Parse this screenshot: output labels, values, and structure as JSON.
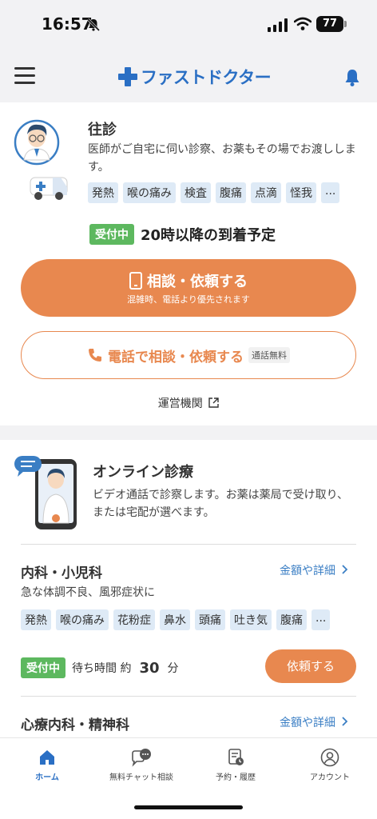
{
  "status": {
    "time": "16:57",
    "battery": "77"
  },
  "header": {
    "brand": "ファストドクター"
  },
  "house_call": {
    "title": "往診",
    "description": "医師がご自宅に伺い診察、お薬もその場でお渡しします。",
    "tags": [
      "発熱",
      "喉の痛み",
      "検査",
      "腹痛",
      "点滴",
      "怪我",
      "..."
    ],
    "status_badge": "受付中",
    "arrival": "20時以降の到着予定",
    "consult_button": "相談・依頼する",
    "consult_sub": "混雑時、電話より優先されます",
    "phone_button": "電話で相談・依頼する",
    "phone_free": "通話無料",
    "operator_link": "運営機関"
  },
  "online": {
    "title": "オンライン診療",
    "description": "ビデオ通話で診察します。お薬は薬局で受け取り、または宅配が選べます。",
    "internal": {
      "title": "内科・小児科",
      "detail_link": "金額や詳細",
      "subtitle": "急な体調不良、風邪症状に",
      "tags": [
        "発熱",
        "喉の痛み",
        "花粉症",
        "鼻水",
        "頭痛",
        "吐き気",
        "腹痛",
        "..."
      ],
      "status_badge": "受付中",
      "wait_prefix": "待ち時間 約",
      "wait_value": "30",
      "wait_unit": "分",
      "request_button": "依頼する"
    },
    "psych": {
      "title": "心療内科・精神科",
      "detail_link": "金額や詳細"
    }
  },
  "tabbar": {
    "items": [
      {
        "label": "ホーム",
        "icon": "home-icon",
        "active": true
      },
      {
        "label": "無料チャット相談",
        "icon": "chat-icon",
        "active": false
      },
      {
        "label": "予約・履歴",
        "icon": "history-icon",
        "active": false
      },
      {
        "label": "アカウント",
        "icon": "account-icon",
        "active": false
      }
    ]
  },
  "colors": {
    "brand_blue": "#2a6fc4",
    "accent_orange": "#e8884f",
    "status_green": "#5db85f",
    "tag_bg": "#deeaf6"
  }
}
